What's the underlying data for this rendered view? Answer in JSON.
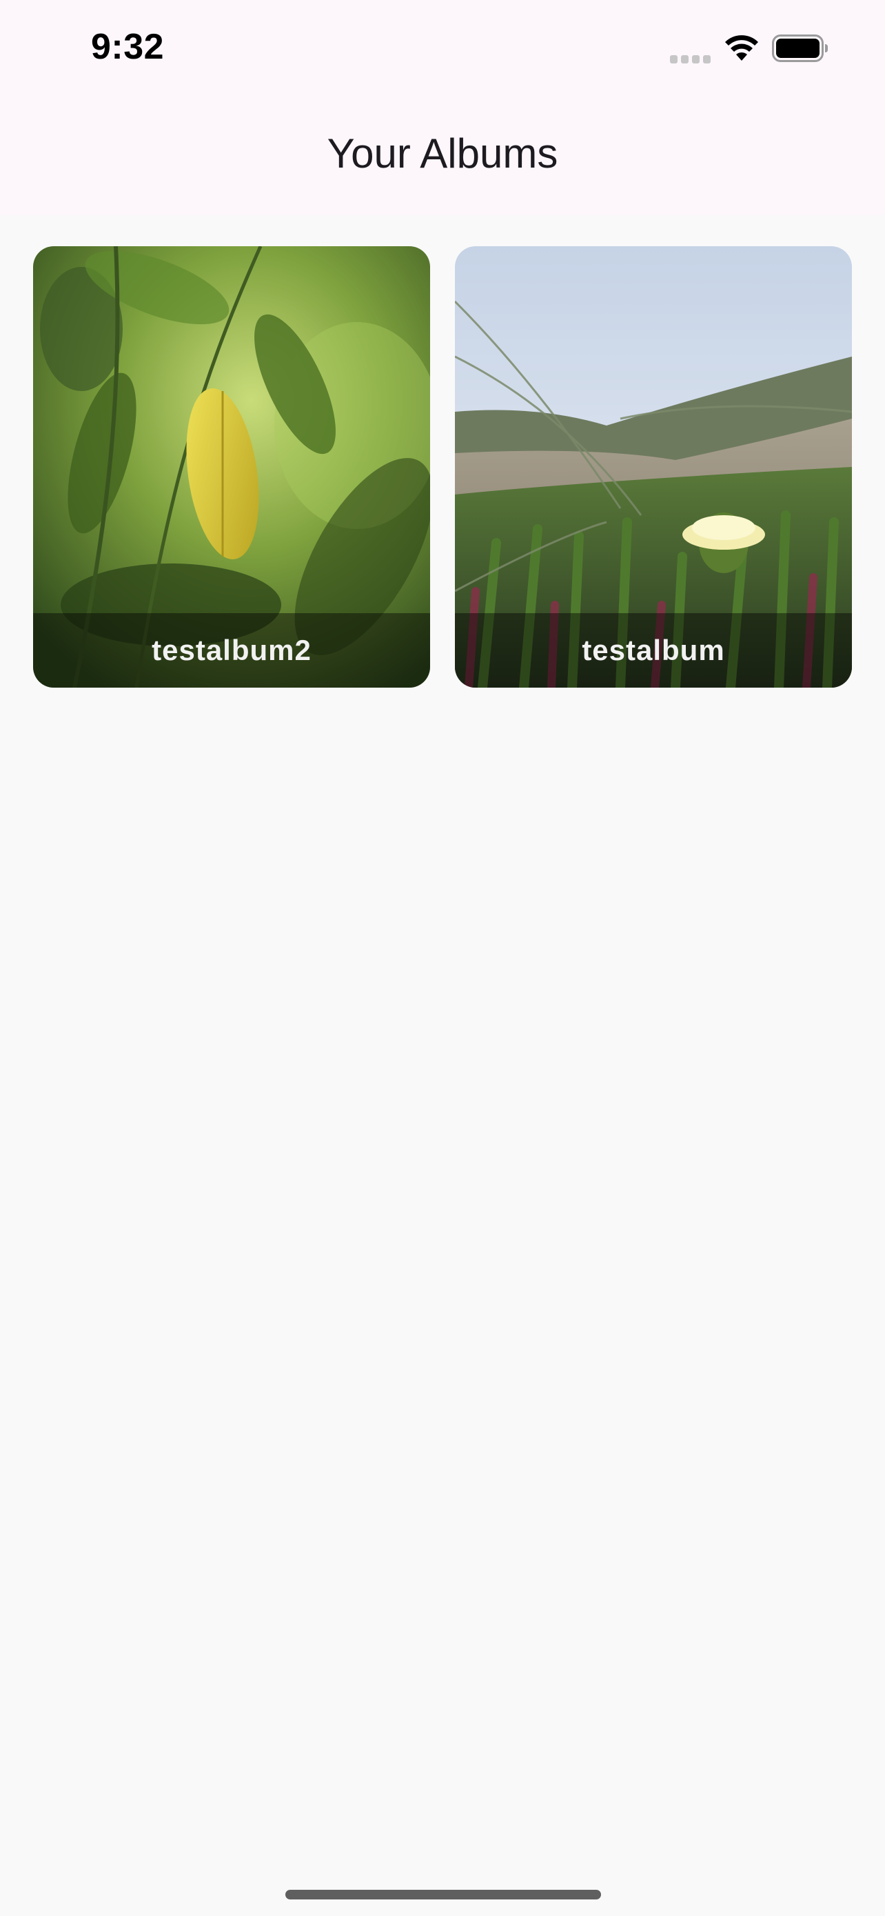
{
  "status_bar": {
    "time": "9:32",
    "icons": [
      "signal-icon",
      "wifi-icon",
      "battery-icon"
    ]
  },
  "header": {
    "title": "Your Albums"
  },
  "albums": [
    {
      "label": "testalbum2",
      "thumbnail": "green-leaves-photo"
    },
    {
      "label": "testalbum",
      "thumbnail": "beach-flower-photo"
    }
  ],
  "colors": {
    "header_bg": "#fdf7fc",
    "page_bg": "#f9f9f9",
    "title_text": "#1d1b20",
    "album_label_text": "#f2f2f2"
  }
}
